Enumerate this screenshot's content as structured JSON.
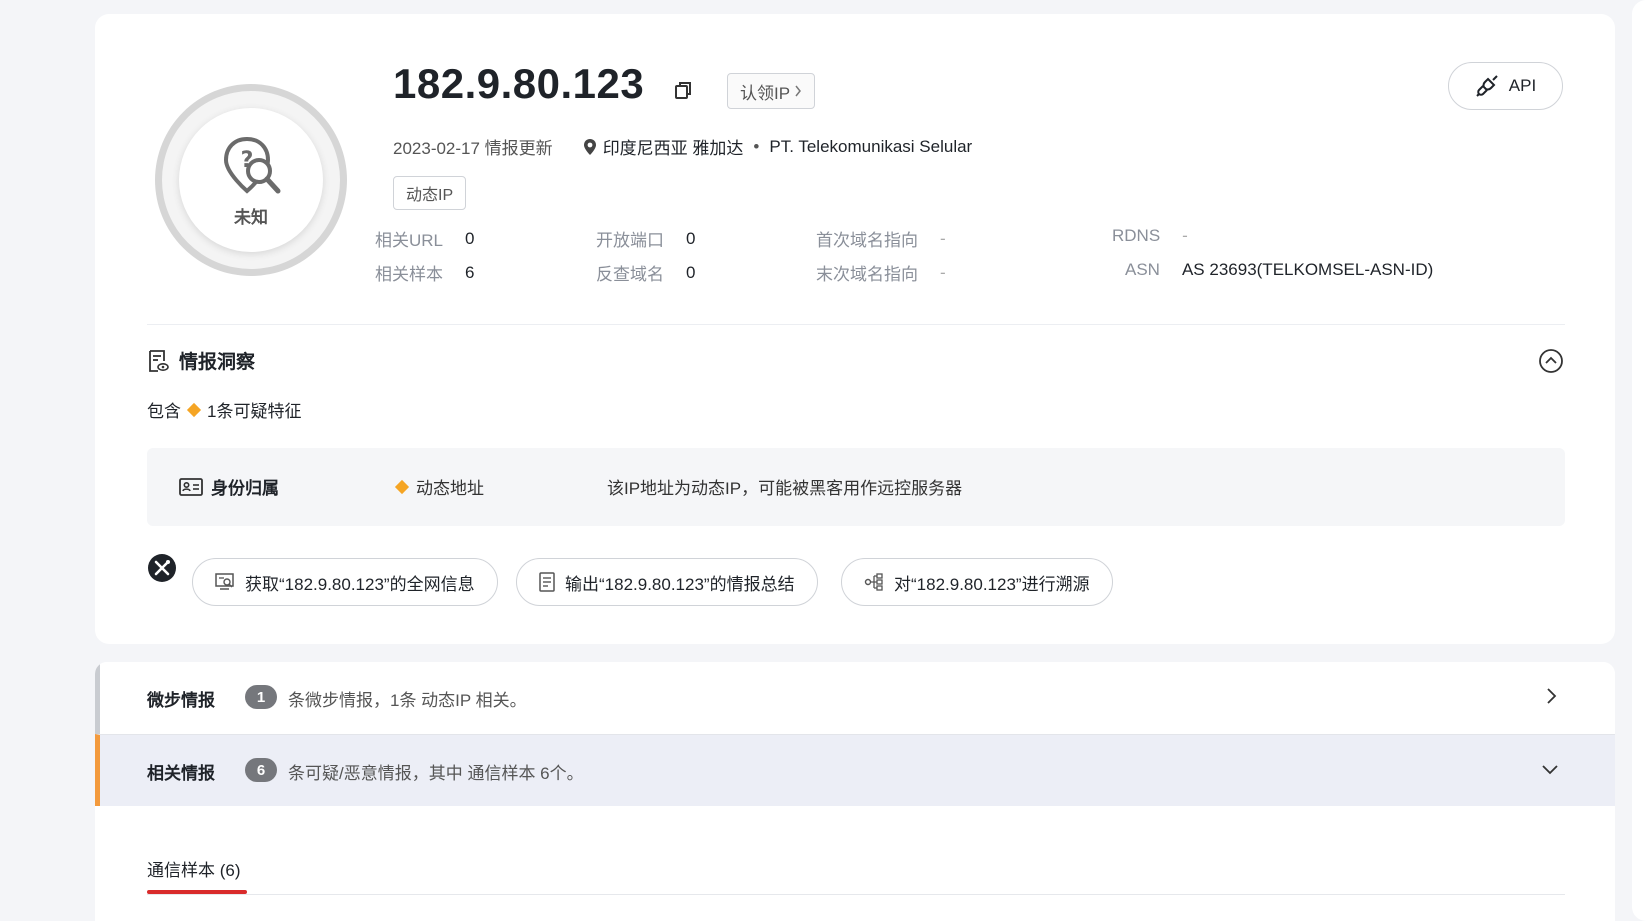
{
  "ip": "182.9.80.123",
  "claim_label": "认领IP",
  "api_label": "API",
  "badge_label": "未知",
  "update_text": "2023-02-17 情报更新",
  "location": "印度尼西亚 雅加达",
  "isp": "PT. Telekomunikasi Selular",
  "tag": "动态IP",
  "stats": {
    "url_k": "相关URL",
    "url_v": "0",
    "port_k": "开放端口",
    "port_v": "0",
    "first_k": "首次域名指向",
    "first_v": "-",
    "rdns_k": "RDNS",
    "rdns_v": "-",
    "sample_k": "相关样本",
    "sample_v": "6",
    "reverse_k": "反查域名",
    "reverse_v": "0",
    "last_k": "末次域名指向",
    "last_v": "-",
    "asn_k": "ASN",
    "asn_v": "AS 23693(TELKOMSEL-ASN-ID)"
  },
  "insight": {
    "title": "情报洞察",
    "contains_prefix": "包含",
    "contains_text": "1条可疑特征",
    "category": "身份归属",
    "feature_tag": "动态地址",
    "feature_desc": "该IP地址为动态IP，可能被黑客用作远控服务器"
  },
  "actions": [
    "获取“182.9.80.123”的全网信息",
    "输出“182.9.80.123”的情报总结",
    "对“182.9.80.123”进行溯源"
  ],
  "micro": {
    "title": "微步情报",
    "count": "1",
    "text": "条微步情报，1条 动态IP 相关。"
  },
  "related": {
    "title": "相关情报",
    "count": "6",
    "text": "条可疑/恶意情报，其中 通信样本 6个。"
  },
  "tab_label": "通信样本 (6)",
  "colors": {
    "accent_red": "#d92b2b",
    "accent_orange": "#f39a3d",
    "diamond": "#f5a524"
  }
}
